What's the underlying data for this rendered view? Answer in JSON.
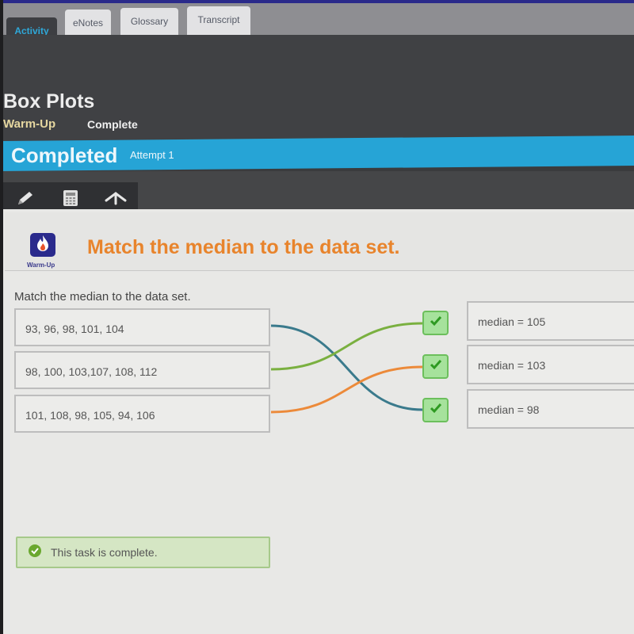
{
  "tabs": [
    {
      "label": "Activity",
      "active": true
    },
    {
      "label": "eNotes",
      "active": false
    },
    {
      "label": "Glossary",
      "active": false
    },
    {
      "label": "Transcript",
      "active": false
    }
  ],
  "header": {
    "title": "Box Plots",
    "section": "Warm-Up",
    "section_status": "Complete"
  },
  "status_bar": {
    "status": "Completed",
    "attempt": "Attempt 1",
    "color": "#26a4d6"
  },
  "toolbar": {
    "tools": [
      {
        "icon": "pencil-icon",
        "label": "Pencil"
      },
      {
        "icon": "calculator-icon",
        "label": "Calculator"
      },
      {
        "icon": "arrow-up-icon",
        "label": "Collapse"
      }
    ]
  },
  "activity": {
    "badge_label": "Warm-Up",
    "heading": "Match the median to the data set.",
    "heading_color": "#e8842c",
    "prompt": "Match the median to the data set.",
    "data_sets": [
      {
        "text": "93, 96, 98, 101, 104"
      },
      {
        "text": "98, 100, 103,107, 108, 112"
      },
      {
        "text": "101, 108, 98, 105, 94, 106"
      }
    ],
    "medians": [
      {
        "text": "median = 105",
        "correct": true
      },
      {
        "text": "median = 103",
        "correct": true
      },
      {
        "text": "median = 98",
        "correct": true
      }
    ],
    "matches": [
      {
        "from": 0,
        "to": 2,
        "color": "#3a7a8c"
      },
      {
        "from": 1,
        "to": 0,
        "color": "#7ab040"
      },
      {
        "from": 2,
        "to": 1,
        "color": "#ec8a3a"
      }
    ],
    "completion_message": "This task is complete."
  }
}
